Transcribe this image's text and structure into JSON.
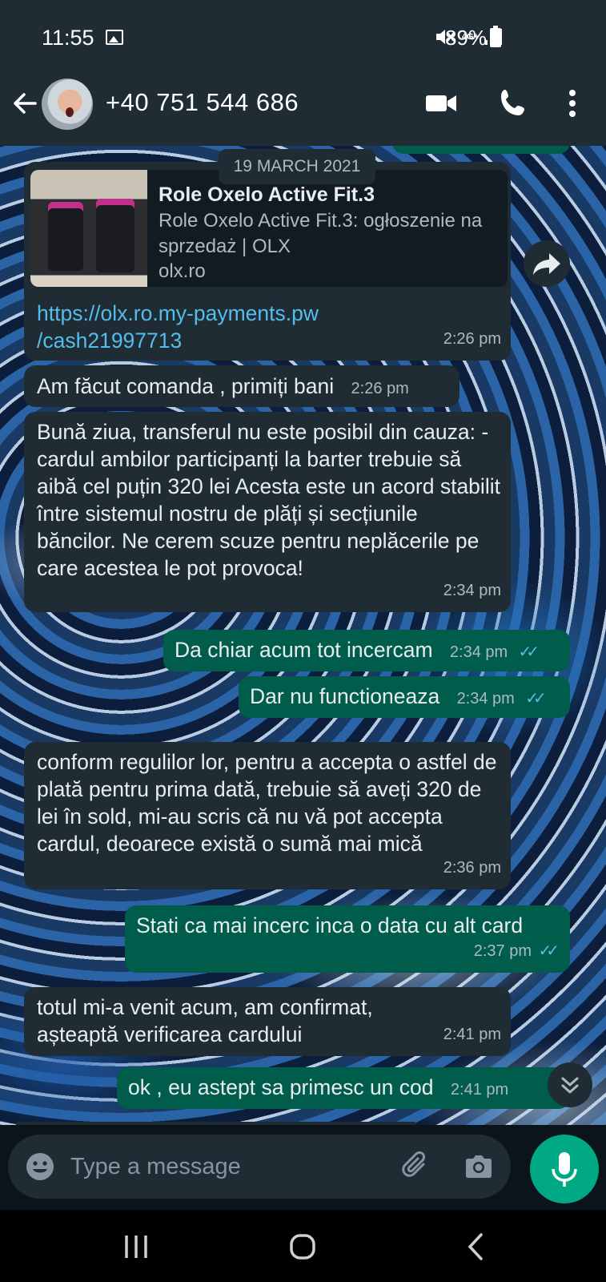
{
  "status_bar": {
    "time": "11:55",
    "network": "4G+",
    "battery": "89%"
  },
  "header": {
    "contact": "+40 751 544 686"
  },
  "chat": {
    "date_label": "19 MARCH 2021",
    "link_preview": {
      "title": "Role Oxelo Active Fit.3",
      "description": "Role Oxelo Active Fit.3: ogłoszenie na sprzedaż | OLX",
      "domain": "olx.ro"
    },
    "messages": [
      {
        "dir": "in",
        "text": "https://olx.ro.my-payments.pw /cash21997713",
        "time": "2:26 pm"
      },
      {
        "dir": "in",
        "text": "Am făcut comanda , primiți bani",
        "time": "2:26 pm"
      },
      {
        "dir": "in",
        "text": "Bună ziua, transferul nu este posibil din cauza: - cardul ambilor participanți la barter trebuie să aibă cel puțin 320 lei Acesta este un acord stabilit între sistemul nostru de plăți și secțiunile băncilor. Ne cerem scuze pentru neplăcerile pe care acestea le pot provoca!",
        "time": "2:34 pm"
      },
      {
        "dir": "out",
        "text": "Da chiar acum tot incercam",
        "time": "2:34 pm"
      },
      {
        "dir": "out",
        "text": "Dar nu functioneaza",
        "time": "2:34 pm"
      },
      {
        "dir": "in",
        "text": "conform regulilor lor, pentru a accepta o astfel de plată pentru prima dată, trebuie să aveți 320 de lei în sold, mi-au scris că nu vă pot accepta cardul, deoarece există o sumă mai mică",
        "time": "2:36 pm"
      },
      {
        "dir": "out",
        "text": "Stati ca mai incerc inca o data cu alt card",
        "time": "2:37 pm"
      },
      {
        "dir": "in",
        "text": "totul mi-a venit acum, am confirmat, așteaptă verificarea cardului",
        "time": "2:41 pm"
      },
      {
        "dir": "out",
        "text": "ok , eu astept sa primesc un cod",
        "time": "2:41 pm"
      }
    ]
  },
  "input": {
    "placeholder": "Type a message"
  },
  "colors": {
    "header_bg": "#1f2c34",
    "incoming_bubble": "#1f2c34",
    "outgoing_bubble": "#005c4b",
    "accent": "#00a884",
    "read_ticks": "#53bdeb"
  },
  "icons": {
    "status": [
      "gallery-icon",
      "mute-icon",
      "signal-icon",
      "battery-icon"
    ],
    "header": [
      "back-arrow-icon",
      "video-call-icon",
      "phone-icon",
      "more-vert-icon"
    ],
    "chat": [
      "forward-icon",
      "double-chevron-down-icon",
      "double-check-icon"
    ],
    "input": [
      "emoji-icon",
      "attach-icon",
      "camera-icon",
      "mic-icon"
    ],
    "nav": [
      "recent-apps-icon",
      "home-icon",
      "back-icon"
    ]
  }
}
